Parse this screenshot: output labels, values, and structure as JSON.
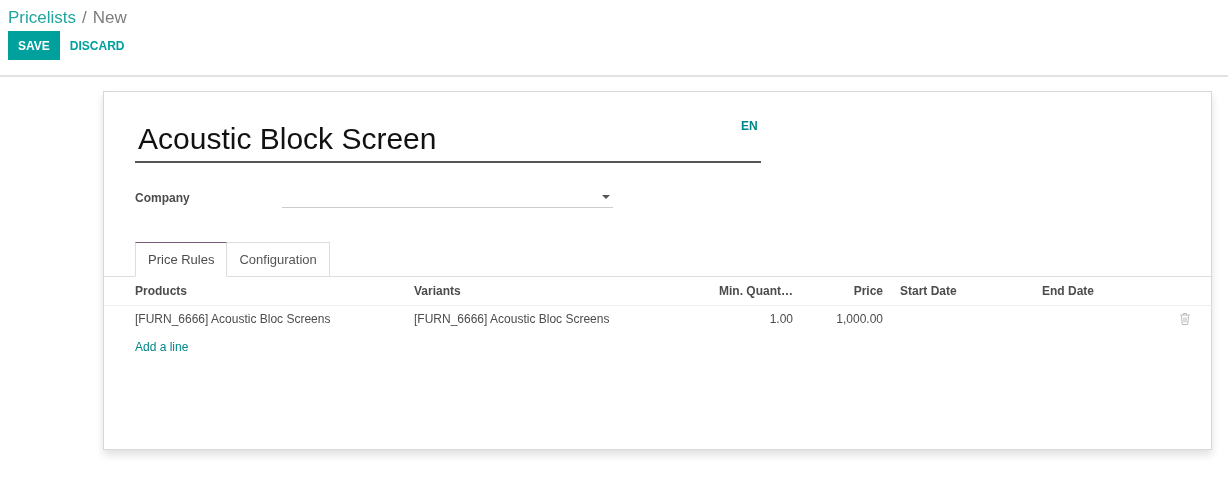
{
  "breadcrumb": [
    {
      "label": "Pricelists",
      "kind": "link"
    },
    {
      "label": "/",
      "kind": "separator"
    },
    {
      "label": "New",
      "kind": "current"
    }
  ],
  "buttons": [
    {
      "label": "SAVE",
      "kind": "primary"
    },
    {
      "label": "DISCARD",
      "kind": "link"
    }
  ],
  "form": {
    "title": "Acoustic Block Screen",
    "language": "EN",
    "fields": [
      {
        "label": "Company",
        "kind": "dropdown"
      }
    ]
  },
  "tabs": [
    {
      "label": "Price Rules",
      "selected": true
    },
    {
      "label": "Configuration",
      "selected": false
    }
  ],
  "table": {
    "columns": [
      {
        "label": "Products",
        "kind": "text"
      },
      {
        "label": "Variants",
        "kind": "text"
      },
      {
        "label": "Min. Quant…",
        "kind": "number"
      },
      {
        "label": "Price",
        "kind": "number"
      },
      {
        "label": "Start Date",
        "kind": "date"
      },
      {
        "label": "End Date",
        "kind": "date"
      }
    ],
    "rows": [
      {
        "cells": [
          "[FURN_6666] Acoustic Bloc Screens",
          "[FURN_6666] Acoustic Bloc Screens",
          "1.00",
          "1,000.00",
          "",
          ""
        ]
      }
    ],
    "add_line": "Add a line"
  }
}
